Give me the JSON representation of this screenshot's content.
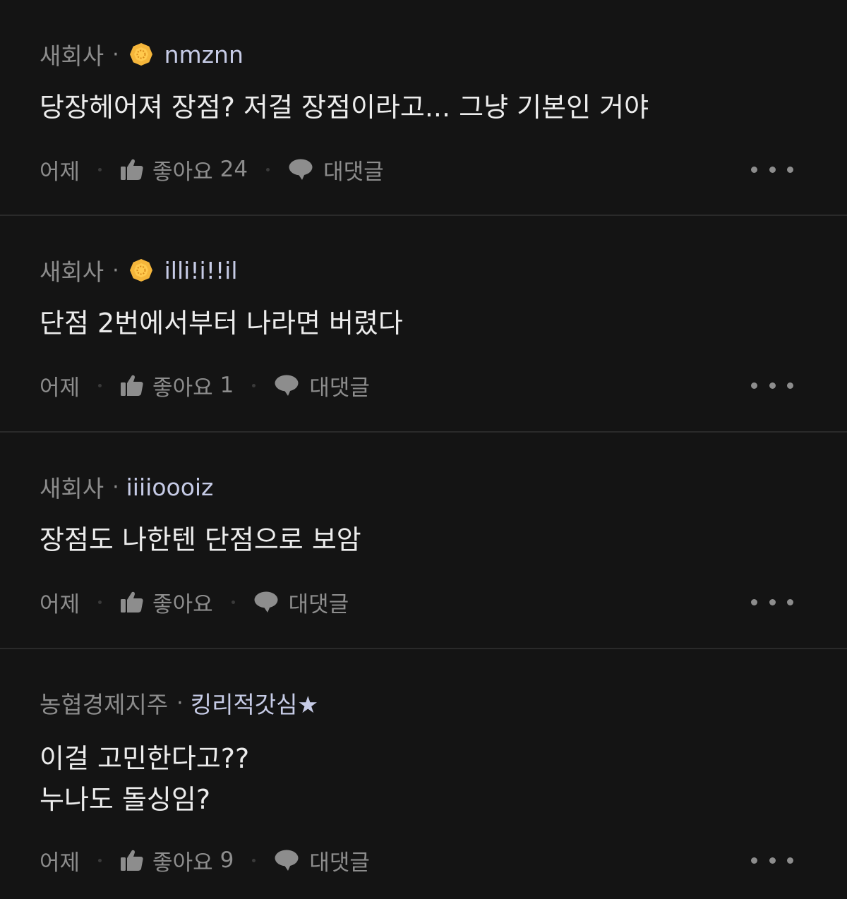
{
  "colors": {
    "background": "#141414",
    "divider": "#2a2a2a",
    "company_text": "#8c8c8c",
    "nickname_text": "#c6cbe6",
    "body_text": "#ececec",
    "action_text": "#8d8d8d",
    "badge": "#f5b63b"
  },
  "labels": {
    "time": "어제",
    "like": "좋아요",
    "reply": "대댓글",
    "meta_separator": "·"
  },
  "comments": [
    {
      "company": "새회사",
      "badge_icon": "gold-badge-icon",
      "nickname": "nmznn",
      "body_lines": [
        "당장헤어져 장점? 저걸 장점이라고... 그냥 기본인 거야"
      ],
      "like_count": "24"
    },
    {
      "company": "새회사",
      "badge_icon": "gold-badge-icon",
      "nickname": "illi!i!!il",
      "body_lines": [
        "단점 2번에서부터 나라면 버렸다"
      ],
      "like_count": "1"
    },
    {
      "company": "새회사",
      "badge_icon": null,
      "nickname": "iiiioooiz",
      "body_lines": [
        "장점도 나한텐 단점으로 보암"
      ],
      "like_count": ""
    },
    {
      "company": "농협경제지주",
      "badge_icon": null,
      "nickname": "킹리적갓심★",
      "body_lines": [
        "이걸 고민한다고??",
        "누나도 돌싱임?"
      ],
      "like_count": "9"
    }
  ]
}
